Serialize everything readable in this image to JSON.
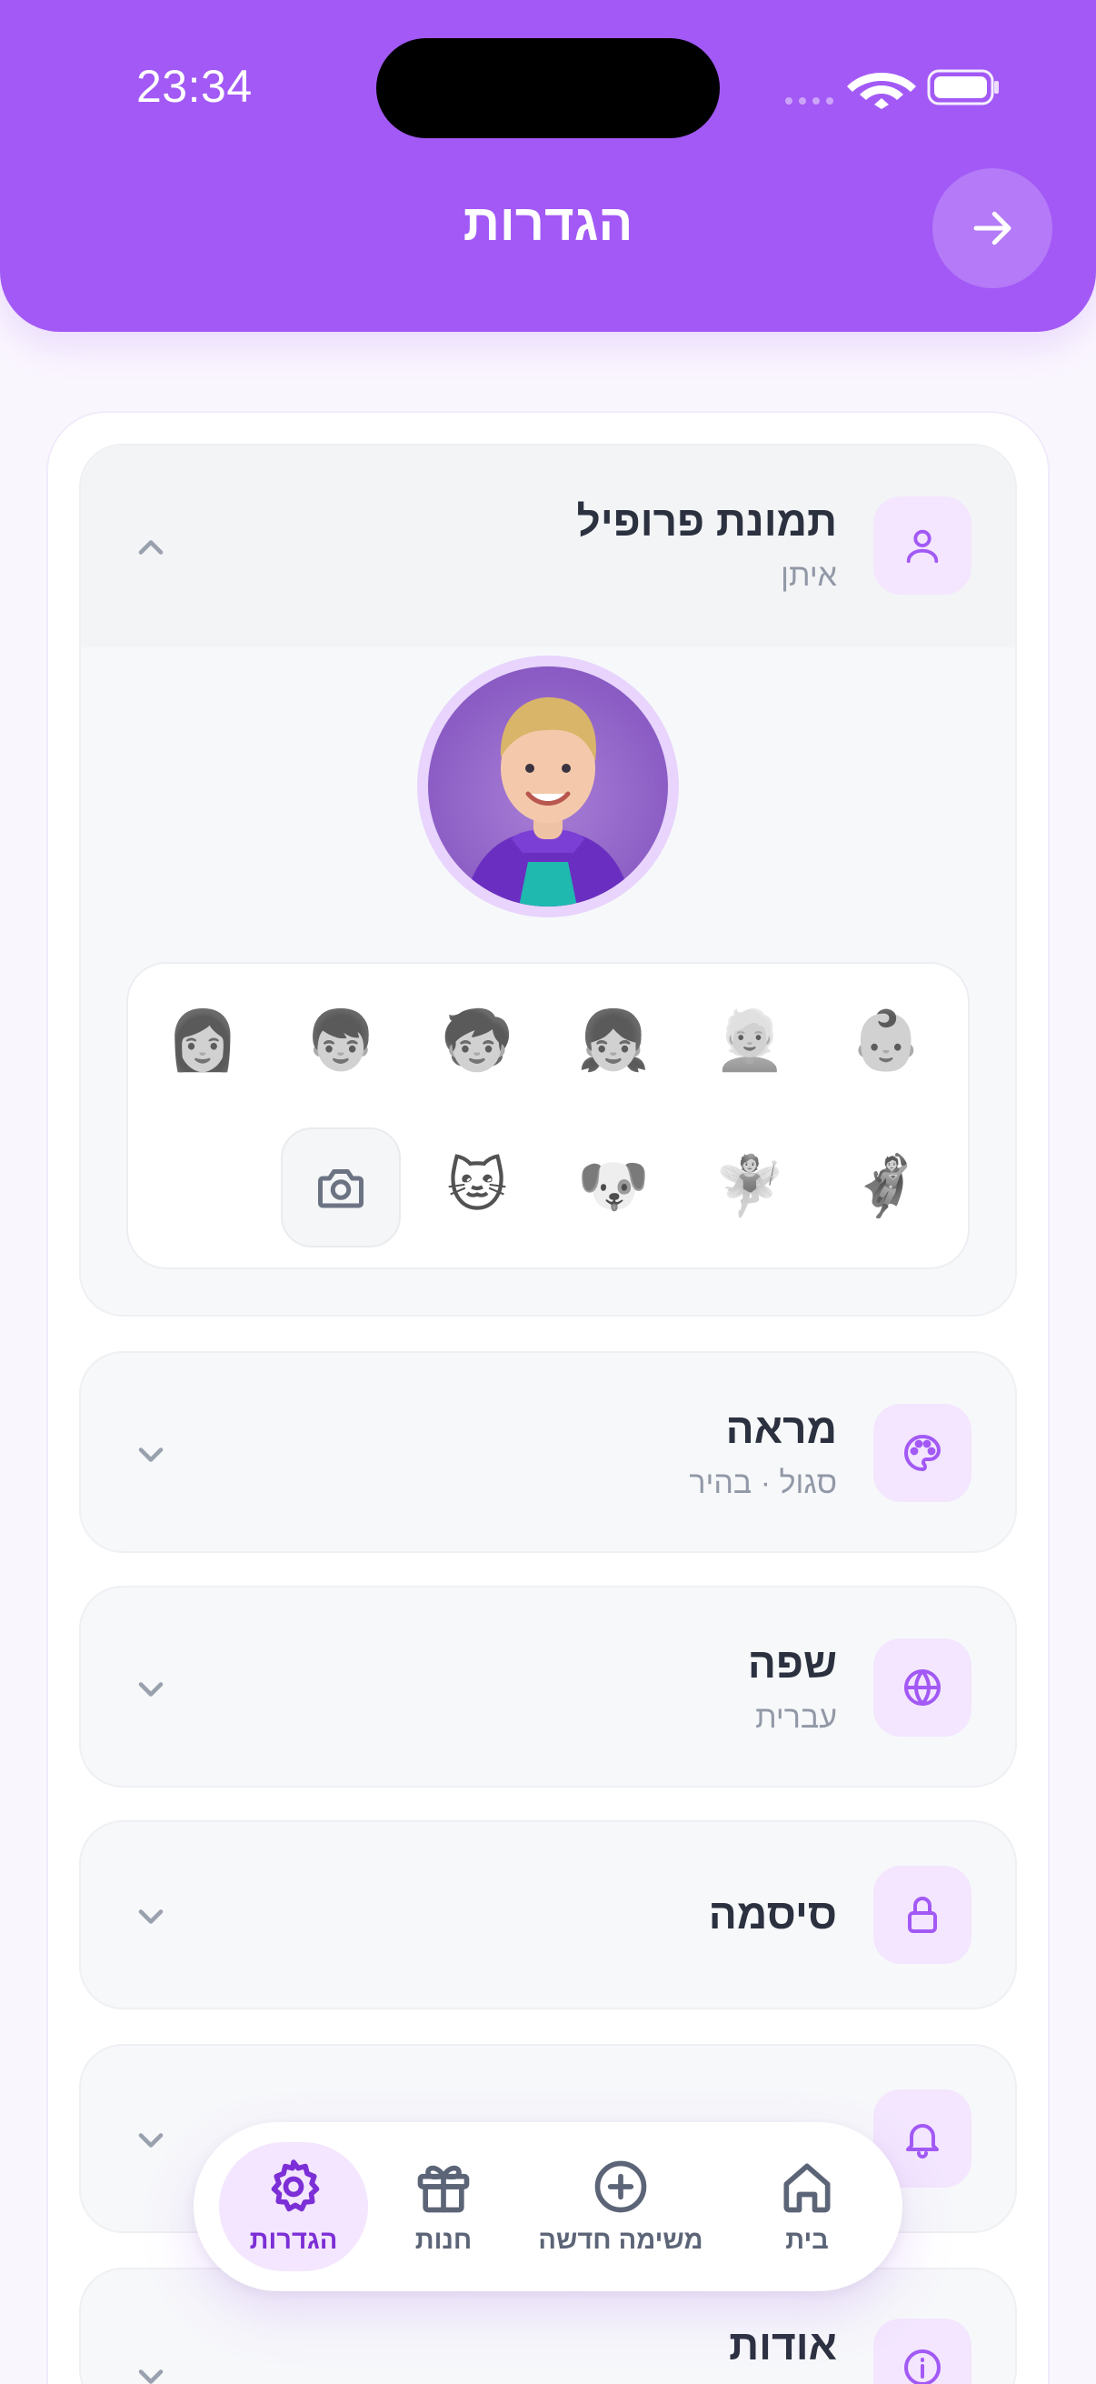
{
  "status_bar": {
    "time": "23:34"
  },
  "header": {
    "title": "הגדרות"
  },
  "sections": {
    "profile": {
      "title": "תמונת פרופיל",
      "subtitle": "איתן"
    },
    "appearance": {
      "title": "מראה",
      "subtitle": "סגול · בהיר"
    },
    "language": {
      "title": "שפה",
      "subtitle": "עברית"
    },
    "password": {
      "title": "סיסמה"
    },
    "about": {
      "title": "אודות"
    }
  },
  "avatar_options": [
    "👩",
    "👦",
    "🧒",
    "👧",
    "👱",
    "👶",
    "🦸",
    "🧚",
    "🐶",
    "🐱"
  ],
  "nav": {
    "home": "בית",
    "new_task": "משימה חדשה",
    "shop": "חנות",
    "settings": "הגדרות"
  },
  "colors": {
    "accent": "#a259f5",
    "accent_dark": "#7c2fd6",
    "icon_bg": "#f3e6fe"
  }
}
